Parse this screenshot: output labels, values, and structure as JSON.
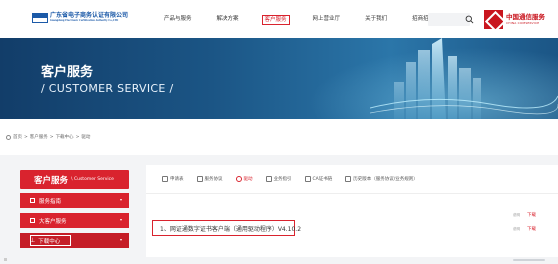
{
  "header": {
    "logo": {
      "abbr": "GDCA",
      "name": "广东省电子商务认证有限公司",
      "subtitle": "Guangdong Electronic Certification Authority Co.,LTD"
    },
    "nav": [
      {
        "label": "产品与服务"
      },
      {
        "label": "解决方案"
      },
      {
        "label": "客户服务",
        "active": true
      },
      {
        "label": "网上营业厅"
      },
      {
        "label": "关于我们"
      },
      {
        "label": "招商招士"
      }
    ],
    "search": {
      "placeholder": ""
    },
    "partner": {
      "name": "中国通信服务",
      "english": "CHINA COMSERVICE"
    }
  },
  "banner": {
    "title": "客户服务",
    "subtitle": "/ CUSTOMER SERVICE /"
  },
  "breadcrumb": {
    "items": [
      "首页",
      "客户服务",
      "下载中心",
      "驱动"
    ],
    "sep": ">"
  },
  "sidebar": {
    "title": "客户服务",
    "title_en": "\\ Customer Service",
    "items": [
      {
        "label": "服务指南"
      },
      {
        "label": "大客户服务"
      },
      {
        "label": "下载中心",
        "active": true
      }
    ]
  },
  "main": {
    "tabs": [
      {
        "label": "申请表"
      },
      {
        "label": "服务协议"
      },
      {
        "label": "驱动",
        "active": true
      },
      {
        "label": "业务指引"
      },
      {
        "label": "CA证书链"
      },
      {
        "label": "历史版本（服务协议/业务规则）"
      }
    ],
    "rows": [
      {
        "title": "1、网证通数字证书客户端（通用驱动程序）V4.10.2"
      }
    ],
    "mini_labels": [
      "说明",
      "说明"
    ],
    "download_label": "下载"
  },
  "colors": {
    "brand_red": "#d9232e",
    "brand_blue": "#1c5aa8",
    "banner_blue": "#1b5585"
  }
}
